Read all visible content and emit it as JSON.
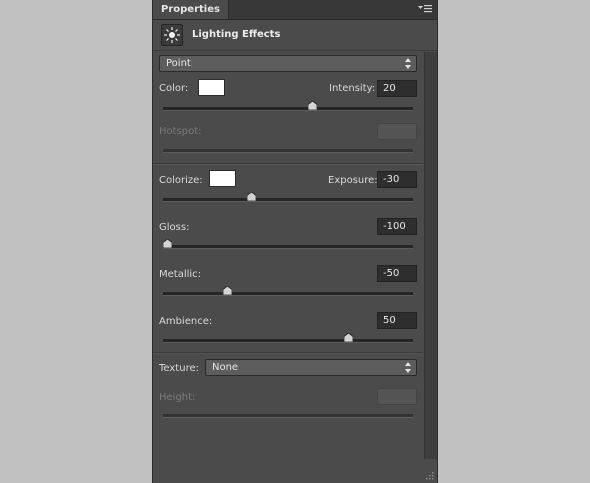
{
  "panel": {
    "tab_label": "Properties"
  },
  "header": {
    "title": "Lighting Effects"
  },
  "light": {
    "type_value": "Point",
    "color_label": "Color:",
    "intensity_label": "Intensity:",
    "intensity_value": "20",
    "intensity_level": 0.6,
    "hotspot_label": "Hotspot:",
    "hotspot_value": ""
  },
  "environment": {
    "colorize_label": "Colorize:",
    "exposure_label": "Exposure:",
    "exposure_value": "-30",
    "exposure_level": 0.35,
    "gloss_label": "Gloss:",
    "gloss_value": "-100",
    "gloss_level": 0.0,
    "metallic_label": "Metallic:",
    "metallic_value": "-50",
    "metallic_level": 0.25,
    "ambience_label": "Ambience:",
    "ambience_value": "50",
    "ambience_level": 0.75
  },
  "texture": {
    "texture_label": "Texture:",
    "texture_value": "None",
    "height_label": "Height:",
    "height_value": ""
  },
  "colors": {
    "light_color": "#ffffff",
    "colorize_color": "#ffffff"
  }
}
